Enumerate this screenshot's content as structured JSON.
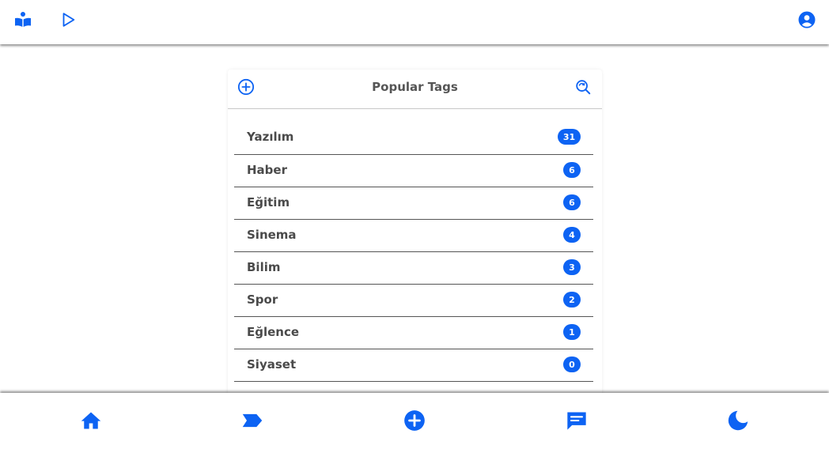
{
  "colors": {
    "accent": "#0d63f3",
    "text": "#4a4a4a",
    "title": "#555555"
  },
  "topbar": {
    "icons": [
      "reader-icon",
      "play-icon",
      "account-icon"
    ]
  },
  "card": {
    "title": "Popular Tags",
    "left_icon": "add-circle-icon",
    "right_icon": "search-refresh-icon"
  },
  "tags": [
    {
      "label": "Yazılım",
      "count": "31"
    },
    {
      "label": "Haber",
      "count": "6"
    },
    {
      "label": "Eğitim",
      "count": "6"
    },
    {
      "label": "Sinema",
      "count": "4"
    },
    {
      "label": "Bilim",
      "count": "3"
    },
    {
      "label": "Spor",
      "count": "2"
    },
    {
      "label": "Eğlence",
      "count": "1"
    },
    {
      "label": "Siyaset",
      "count": "0"
    },
    {
      "label": "",
      "count": ""
    }
  ],
  "bottombar": {
    "icons": [
      "home-icon",
      "tag-icon",
      "add-icon",
      "chat-icon",
      "dark-mode-icon"
    ]
  }
}
